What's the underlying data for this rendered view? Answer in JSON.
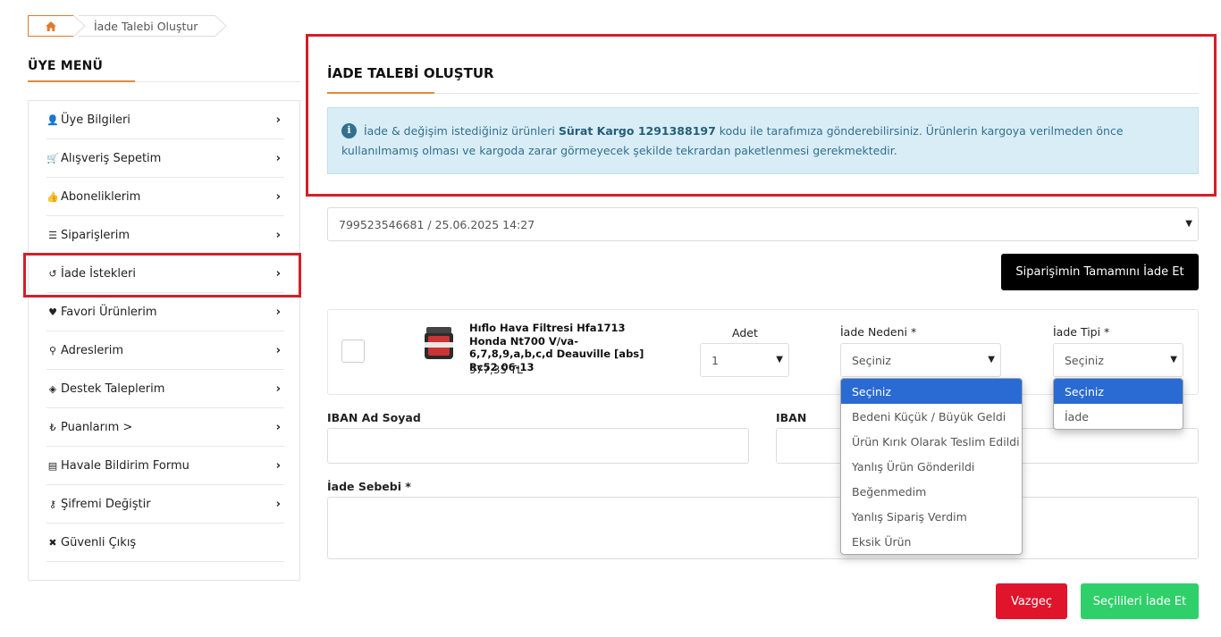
{
  "breadcrumb": {
    "home_icon": "home-icon",
    "current": "İade Talebi Oluştur"
  },
  "sidebar": {
    "title": "ÜYE MENÜ",
    "items": [
      {
        "label": "Üye Bilgileri",
        "icon": "user-icon"
      },
      {
        "label": "Alışveriş Sepetim",
        "icon": "cart-icon"
      },
      {
        "label": "Aboneliklerim",
        "icon": "thumbs-up-icon"
      },
      {
        "label": "Siparişlerim",
        "icon": "list-icon"
      },
      {
        "label": "İade İstekleri",
        "icon": "undo-icon"
      },
      {
        "label": "Favori Ürünlerim",
        "icon": "heart-icon"
      },
      {
        "label": "Adreslerim",
        "icon": "map-marker-icon"
      },
      {
        "label": "Destek Taleplerim",
        "icon": "ticket-icon"
      },
      {
        "label": "Puanlarım >",
        "icon": "lira-icon"
      },
      {
        "label": "Havale Bildirim Formu",
        "icon": "file-icon"
      },
      {
        "label": "Şifremi Değiştir",
        "icon": "key-icon"
      },
      {
        "label": "Güvenli Çıkış",
        "icon": "close-icon"
      }
    ]
  },
  "main": {
    "title": "İADE TALEBİ OLUŞTUR",
    "info": {
      "prefix": "İade & değişim istediğiniz ürünleri ",
      "code": "Sürat Kargo 1291388197",
      "line1_suffix": " kodu ile tarafımıza gönderebilirsiniz. Ürünlerin kargoya verilmeden önce",
      "line2": "kullanılmamış olması ve kargoda zarar görmeyecek şekilde tekrardan paketlenmesi gerekmektedir."
    },
    "order_select": "799523546681 / 25.06.2025 14:27",
    "return_all_button": "Siparişimin Tamamını İade Et",
    "product": {
      "name": "Hıflo Hava Filtresi Hfa1713 Honda Nt700 V/va-6,7,8,9,a,b,c,d Deauville [abs] Rc52 06-13",
      "price": "977,35 TL",
      "qty_label": "Adet",
      "qty_value": "1",
      "reason_label": "İade Nedeni *",
      "reason_value": "Seçiniz",
      "type_label": "İade Tipi *",
      "type_value": "Seçiniz"
    },
    "reason_options": [
      "Seçiniz",
      "Bedeni Küçük / Büyük Geldi",
      "Ürün Kırık Olarak Teslim Edildi",
      "Yanlış Ürün Gönderildi",
      "Beğenmedim",
      "Yanlış Sipariş Verdim",
      "Eksik Ürün"
    ],
    "type_options": [
      "Seçiniz",
      "İade"
    ],
    "iban_name_label": "IBAN Ad Soyad",
    "iban_label": "IBAN",
    "reason_text_label": "İade Sebebi *",
    "cancel_button": "Vazgeç",
    "submit_button": "Seçilileri İade Et"
  },
  "colors": {
    "accent": "#e08a3c",
    "highlight": "#d21f2a",
    "info_bg": "#d9edf7",
    "info_text": "#31708f",
    "cancel": "#e0152c",
    "submit": "#2fcf6a",
    "select_blue": "#2a6ad3"
  }
}
